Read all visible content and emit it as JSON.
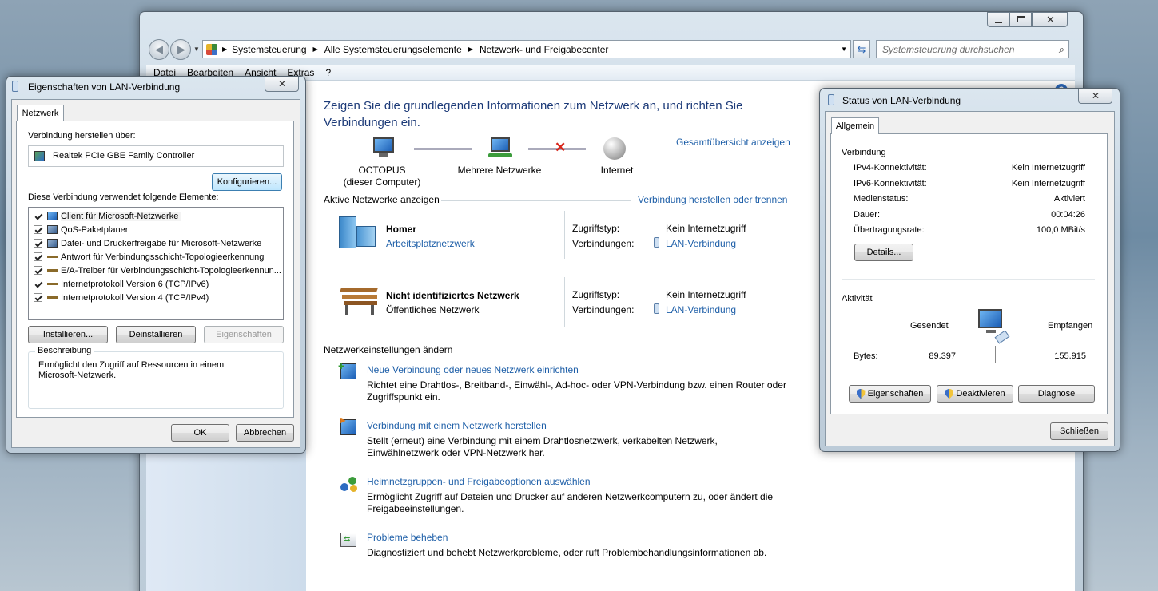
{
  "main_window": {
    "breadcrumb": [
      "Systemsteuerung",
      "Alle Systemsteuerungselemente",
      "Netzwerk- und Freigabecenter"
    ],
    "search_placeholder": "Systemsteuerung durchsuchen",
    "menu": [
      "Datei",
      "Bearbeiten",
      "Ansicht",
      "Extras",
      "?"
    ],
    "heading": "Zeigen Sie die grundlegenden Informationen zum Netzwerk an, und richten Sie Verbindungen ein.",
    "full_map_link": "Gesamtübersicht anzeigen",
    "map": {
      "computer": "OCTOPUS",
      "computer_sub": "(dieser Computer)",
      "multiple": "Mehrere Netzwerke",
      "internet": "Internet"
    },
    "active_networks_label": "Aktive Netzwerke anzeigen",
    "connect_link": "Verbindung herstellen oder trennen",
    "networks": [
      {
        "name": "Homer",
        "type": "Arbeitsplatznetzwerk",
        "access_label": "Zugriffstyp:",
        "access": "Kein Internetzugriff",
        "conn_label": "Verbindungen:",
        "conn": "LAN-Verbindung"
      },
      {
        "name": "Nicht identifiziertes Netzwerk",
        "type": "Öffentliches Netzwerk",
        "access_label": "Zugriffstyp:",
        "access": "Kein Internetzugriff",
        "conn_label": "Verbindungen:",
        "conn": "LAN-Verbindung"
      }
    ],
    "settings_label": "Netzwerkeinstellungen ändern",
    "tasks": [
      {
        "title": "Neue Verbindung oder neues Netzwerk einrichten",
        "desc": "Richtet eine Drahtlos-, Breitband-, Einwähl-, Ad-hoc- oder VPN-Verbindung bzw. einen Router oder Zugriffspunkt ein."
      },
      {
        "title": "Verbindung mit einem Netzwerk herstellen",
        "desc": "Stellt (erneut) eine Verbindung mit einem Drahtlosnetzwerk, verkabelten Netzwerk, Einwählnetzwerk oder VPN-Netzwerk her."
      },
      {
        "title": "Heimnetzgruppen- und Freigabeoptionen auswählen",
        "desc": "Ermöglicht Zugriff auf Dateien und Drucker auf anderen Netzwerkcomputern zu, oder ändert die Freigabeeinstellungen."
      },
      {
        "title": "Probleme beheben",
        "desc": "Diagnostiziert und behebt Netzwerkprobleme, oder ruft Problembehandlungsinformationen ab."
      }
    ]
  },
  "props_dialog": {
    "title": "Eigenschaften von LAN-Verbindung",
    "tab": "Netzwerk",
    "connect_via": "Verbindung herstellen über:",
    "adapter": "Realtek PCIe GBE Family Controller",
    "configure": "Konfigurieren...",
    "elements_label": "Diese Verbindung verwendet folgende Elemente:",
    "elements": [
      "Client für Microsoft-Netzwerke",
      "QoS-Paketplaner",
      "Datei- und Druckerfreigabe für Microsoft-Netzwerke",
      "Antwort für Verbindungsschicht-Topologieerkennung",
      "E/A-Treiber für Verbindungsschicht-Topologieerkennun...",
      "Internetprotokoll Version 6 (TCP/IPv6)",
      "Internetprotokoll Version 4 (TCP/IPv4)"
    ],
    "install": "Installieren...",
    "uninstall": "Deinstallieren",
    "properties": "Eigenschaften",
    "desc_label": "Beschreibung",
    "desc": "Ermöglicht den Zugriff auf Ressourcen in einem Microsoft-Netzwerk.",
    "ok": "OK",
    "cancel": "Abbrechen"
  },
  "status_dialog": {
    "title": "Status von LAN-Verbindung",
    "tab": "Allgemein",
    "connection_label": "Verbindung",
    "rows": [
      {
        "k": "IPv4-Konnektivität:",
        "v": "Kein Internetzugriff"
      },
      {
        "k": "IPv6-Konnektivität:",
        "v": "Kein Internetzugriff"
      },
      {
        "k": "Medienstatus:",
        "v": "Aktiviert"
      },
      {
        "k": "Dauer:",
        "v": "00:04:26"
      },
      {
        "k": "Übertragungsrate:",
        "v": "100,0 MBit/s"
      }
    ],
    "details": "Details...",
    "activity_label": "Aktivität",
    "sent": "Gesendet",
    "received": "Empfangen",
    "bytes_label": "Bytes:",
    "bytes_sent": "89.397",
    "bytes_received": "155.915",
    "btn_props": "Eigenschaften",
    "btn_disable": "Deaktivieren",
    "btn_diag": "Diagnose",
    "close": "Schließen"
  }
}
